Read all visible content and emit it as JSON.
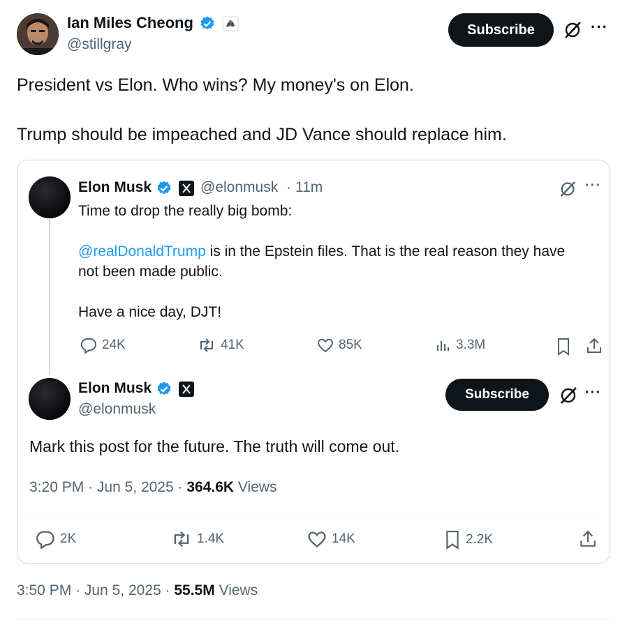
{
  "main_post": {
    "author_name": "Ian Miles Cheong",
    "author_handle": "@stillgray",
    "subscribe_label": "Subscribe",
    "more_label": "···",
    "text_line1": "President vs Elon. Who wins? My money's on Elon.",
    "text_line2": "Trump should be impeached and JD Vance should replace him.",
    "time": "3:50 PM",
    "dot": "·",
    "date": "Jun 5, 2025",
    "views_count": "55.5M",
    "views_label": "Views"
  },
  "quoted_post": {
    "author_name": "Elon Musk",
    "author_handle": "@elonmusk",
    "time_ago": "11m",
    "dot": "·",
    "more_label": "···",
    "line1": "Time to drop the really big bomb:",
    "mention": "@realDonaldTrump",
    "line2_rest": " is in the Epstein files. That is the real reason they have",
    "line3": "not been made public.",
    "line4": "Have a nice day, DJT!",
    "replies": "24K",
    "reposts": "41K",
    "likes": "85K",
    "views": "3.3M"
  },
  "reply_post": {
    "author_name": "Elon Musk",
    "author_handle": "@elonmusk",
    "subscribe_label": "Subscribe",
    "more_label": "···",
    "text": "Mark this post for the future. The truth will come out.",
    "time": "3:20 PM",
    "dot": "·",
    "date": "Jun 5, 2025",
    "views_count": "364.6K",
    "views_label": "Views",
    "replies": "2K",
    "reposts": "1.4K",
    "likes": "14K",
    "bookmarks": "2.2K"
  },
  "colors": {
    "verified": "#1d9bf0",
    "mention": "#1d9bf0",
    "text": "#0f1419",
    "muted": "#536471",
    "border": "#cfd9de"
  }
}
